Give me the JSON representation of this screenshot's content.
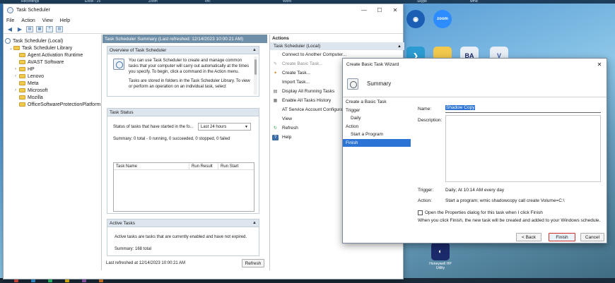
{
  "window": {
    "title": "Task Scheduler",
    "menu": [
      "File",
      "Action",
      "View",
      "Help"
    ]
  },
  "tree": {
    "root": "Task Scheduler (Local)",
    "library": "Task Scheduler Library",
    "folders": [
      "Agent Activation Runtime",
      "AVAST Software",
      "HP",
      "Lenovo",
      "Meta",
      "Microsoft",
      "Mozilla",
      "OfficeSoftwareProtectionPlatform"
    ]
  },
  "summary": {
    "header": "Task Scheduler Summary (Last refreshed: 12/14/2023 10:00:21 AM)",
    "overview_title": "Overview of Task Scheduler",
    "overview_p1": "You can use Task Scheduler to create and manage common tasks that your computer will carry out automatically at the times you specify. To begin, click a command in the Action menu.",
    "overview_p2": "Tasks are stored in folders in the Task Scheduler Library. To view or perform an operation on an individual task, select",
    "status_title": "Task Status",
    "status_label": "Status of tasks that have started in the fo...",
    "status_range": "Last 24 hours",
    "status_summary": "Summary: 0 total - 0 running, 0 succeeded, 0 stopped, 0 failed",
    "columns": [
      "Task Name",
      "Run Result",
      "Run Start"
    ],
    "active_title": "Active Tasks",
    "active_desc": "Active tasks are tasks that are currently enabled and have not expired.",
    "active_summary": "Summary: 168 total",
    "last_refreshed": "Last refreshed at 12/14/2023 10:00:21 AM",
    "refresh_btn": "Refresh"
  },
  "actions": {
    "header": "Actions",
    "subheader": "Task Scheduler (Local)",
    "items": [
      {
        "label": "Connect to Another Computer...",
        "disabled": false
      },
      {
        "label": "Create Basic Task...",
        "disabled": true
      },
      {
        "label": "Create Task...",
        "disabled": false
      },
      {
        "label": "Import Task...",
        "disabled": false
      },
      {
        "label": "Display All Running Tasks",
        "disabled": false
      },
      {
        "label": "Enable All Tasks History",
        "disabled": false
      },
      {
        "label": "AT Service Account Configuration",
        "disabled": false
      },
      {
        "label": "View",
        "disabled": false
      },
      {
        "label": "Refresh",
        "disabled": false
      },
      {
        "label": "Help",
        "disabled": false
      }
    ]
  },
  "wizard": {
    "title": "Create Basic Task Wizard",
    "heading": "Summary",
    "steps": [
      {
        "label": "Create a Basic Task",
        "indent": false,
        "selected": false
      },
      {
        "label": "Trigger",
        "indent": false,
        "selected": false
      },
      {
        "label": "Daily",
        "indent": true,
        "selected": false
      },
      {
        "label": "Action",
        "indent": false,
        "selected": false
      },
      {
        "label": "Start a Program",
        "indent": true,
        "selected": false
      },
      {
        "label": "Finish",
        "indent": false,
        "selected": true
      }
    ],
    "name_label": "Name:",
    "name_value": "Shadow Copy",
    "desc_label": "Description:",
    "trigger_label": "Trigger:",
    "trigger_value": "Daily; At 10:14 AM every day",
    "action_label": "Action:",
    "action_value": "Start a program; wmic shadowcopy call create Volume=C:\\",
    "checkbox_label": "Open the Properties dialog for this task when I click Finish",
    "finish_note": "When you click Finish, the new task will be created and added to your Windows schedule.",
    "back_btn": "< Back",
    "finish_btn": "Finish",
    "cancel_btn": "Cancel"
  },
  "desktop": {
    "icons": [
      {
        "label": "zoom",
        "color": "#2d8cff"
      },
      {
        "label": "BA",
        "color": "#e8eef6"
      },
      {
        "label": "Honeywell HP Utility",
        "color": "#1b2a6b"
      }
    ],
    "top_items": [
      "Recordings",
      "Excel - 25",
      "Zoom",
      "vnc",
      "Word",
      "Skype",
      "wmic"
    ]
  }
}
